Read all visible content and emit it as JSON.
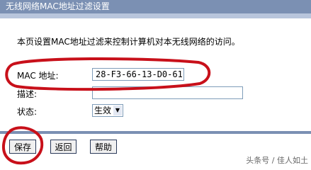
{
  "header": {
    "title": "无线网络MAC地址过滤设置"
  },
  "intro": {
    "text": "本页设置MAC地址过滤来控制计算机对本无线网络的访问。"
  },
  "form": {
    "mac_label": "MAC 地址:",
    "mac_value": "28-F3-66-13-D0-61",
    "desc_label": "描述:",
    "desc_value": "",
    "status_label": "状态:",
    "status_selected": "生效",
    "status_arrow_icon": "dropdown-arrow-icon"
  },
  "buttons": {
    "save": "保存",
    "back": "返回",
    "help": "帮助"
  },
  "watermark": {
    "text": "头条号 / 佳人如土"
  },
  "annotation": {
    "color": "#c8101a"
  }
}
